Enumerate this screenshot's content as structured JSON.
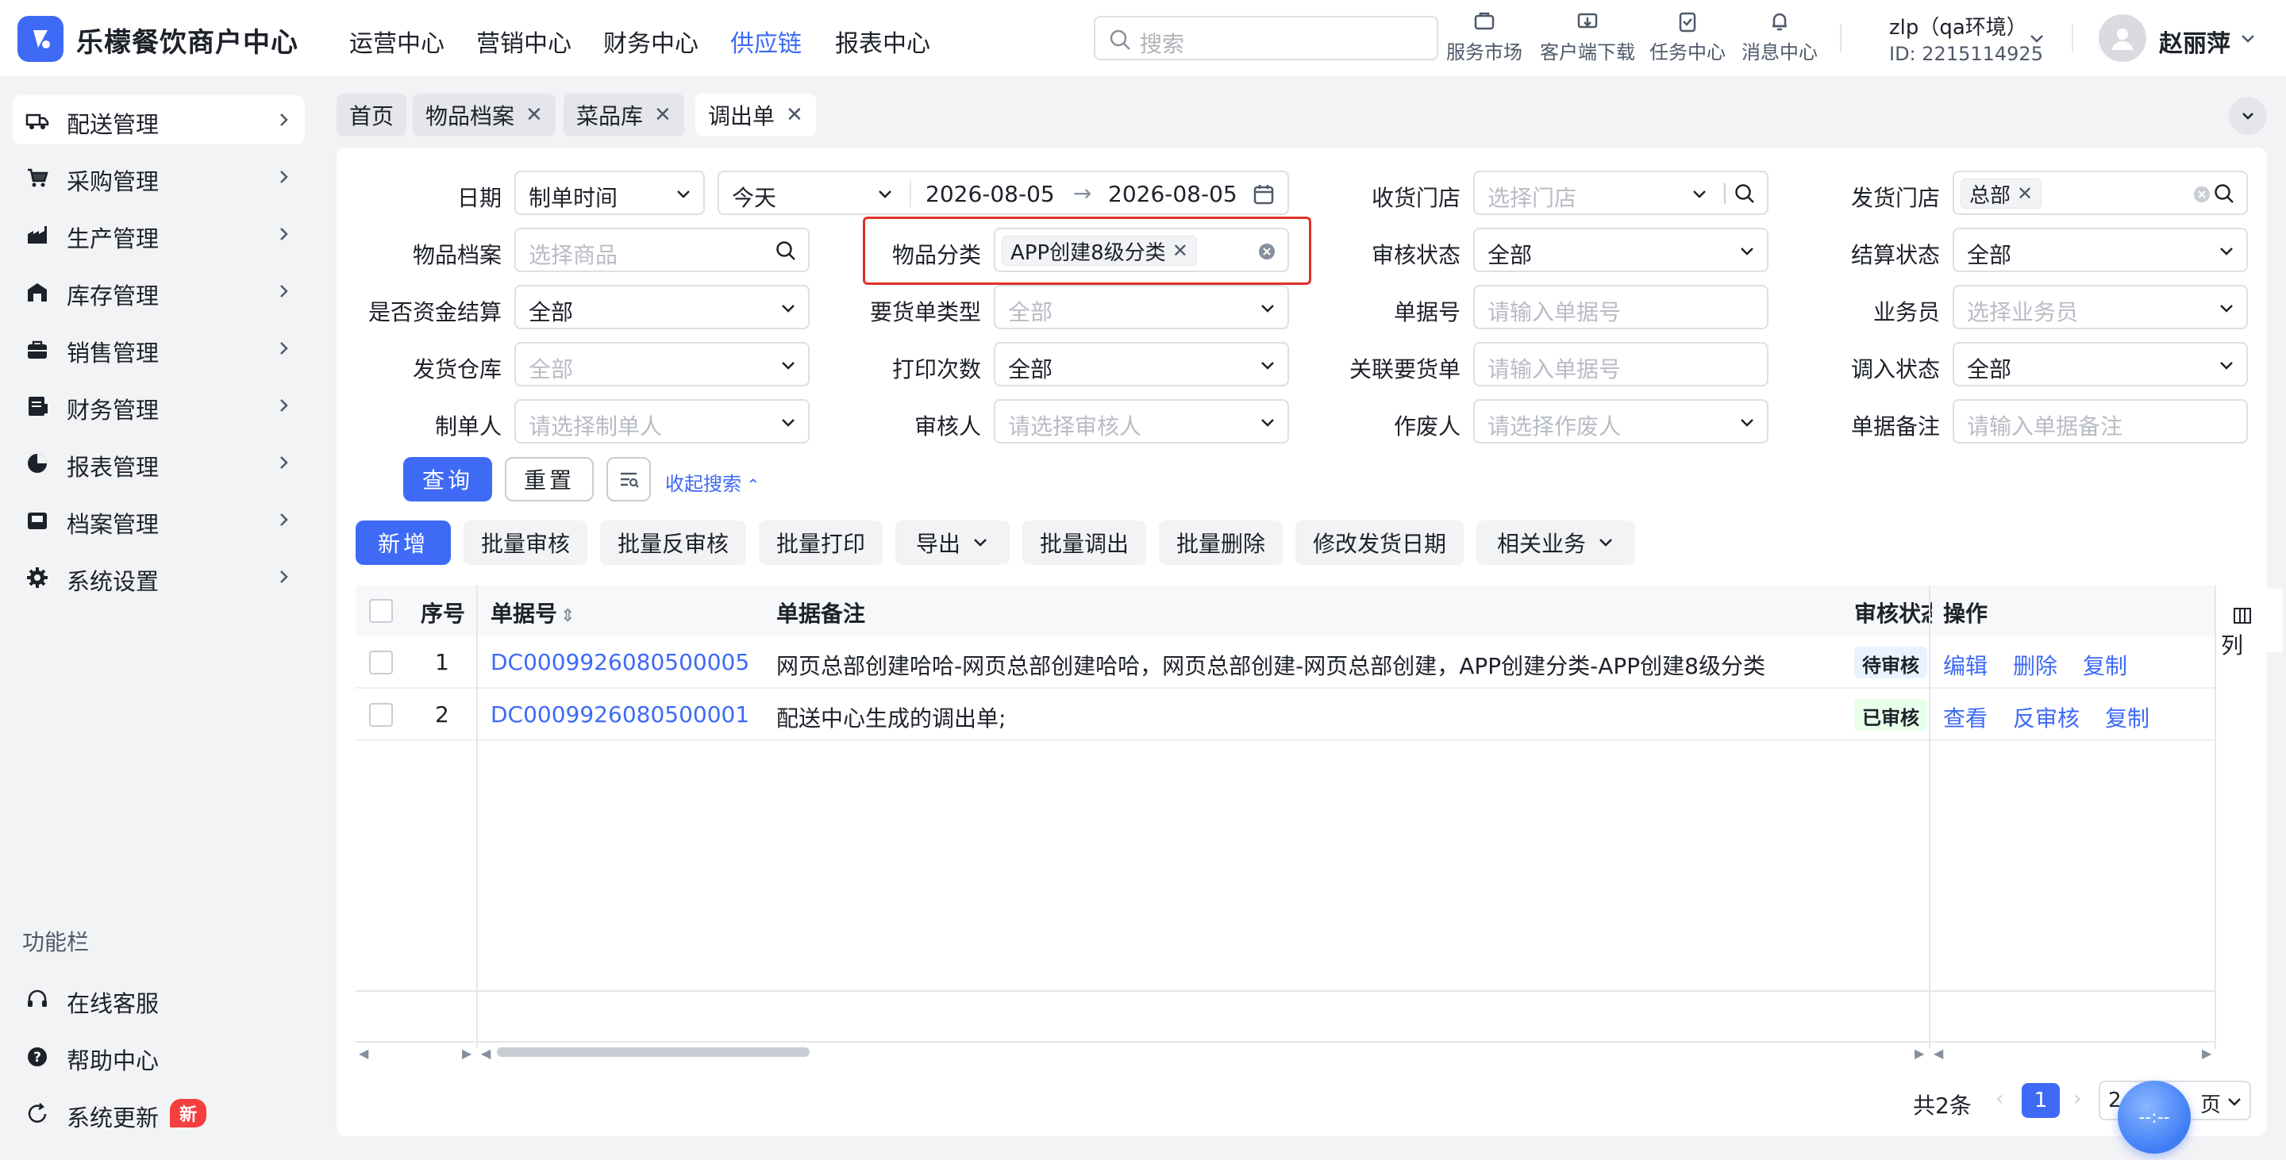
{
  "app": {
    "title": "乐檬餐饮商户中心"
  },
  "topnav": [
    "运营中心",
    "营销中心",
    "财务中心",
    "供应链",
    "报表中心"
  ],
  "search": {
    "placeholder": "搜索"
  },
  "toolbar_icons": [
    {
      "label": "服务市场",
      "icon": "store-icon"
    },
    {
      "label": "客户端下载",
      "icon": "download-icon"
    },
    {
      "label": "任务中心",
      "icon": "clipboard-icon"
    },
    {
      "label": "消息中心",
      "icon": "bell-icon"
    }
  ],
  "account": {
    "name": "zlp（qa环境）",
    "id": "ID: 2215114925",
    "user": "赵丽萍"
  },
  "sidebar": {
    "items": [
      {
        "label": "配送管理",
        "icon": "truck-icon"
      },
      {
        "label": "采购管理",
        "icon": "cart-icon"
      },
      {
        "label": "生产管理",
        "icon": "factory-icon"
      },
      {
        "label": "库存管理",
        "icon": "warehouse-icon"
      },
      {
        "label": "销售管理",
        "icon": "bag-icon"
      },
      {
        "label": "财务管理",
        "icon": "ledger-icon"
      },
      {
        "label": "报表管理",
        "icon": "pie-chart-icon"
      },
      {
        "label": "档案管理",
        "icon": "archive-icon"
      },
      {
        "label": "系统设置",
        "icon": "gear-icon"
      }
    ],
    "func_title": "功能栏",
    "func_items": [
      {
        "label": "在线客服",
        "icon": "headset-icon"
      },
      {
        "label": "帮助中心",
        "icon": "help-icon"
      },
      {
        "label": "系统更新",
        "icon": "refresh-icon"
      }
    ],
    "new_badge": "新"
  },
  "tabs": [
    "首页",
    "物品档案",
    "菜品库",
    "调出单"
  ],
  "filters": {
    "date_label": "日期",
    "date_type": "制单时间",
    "date_range": "今天",
    "date_from": "2026-08-05",
    "date_to": "2026-08-05",
    "receive_store_label": "收货门店",
    "receive_store_ph": "选择门店",
    "send_store_label": "发货门店",
    "send_store_tag": "总部",
    "item_label": "物品档案",
    "item_ph": "选择商品",
    "category_label": "物品分类",
    "category_tag": "APP创建8级分类",
    "audit_label": "审核状态",
    "audit_val": "全部",
    "settle_label": "结算状态",
    "settle_val": "全部",
    "fund_label": "是否资金结算",
    "fund_val": "全部",
    "order_type_label": "要货单类型",
    "order_type_ph": "全部",
    "doc_no_label": "单据号",
    "doc_no_ph": "请输入单据号",
    "salesman_label": "业务员",
    "salesman_ph": "选择业务员",
    "warehouse_label": "发货仓库",
    "warehouse_ph": "全部",
    "print_label": "打印次数",
    "print_val": "全部",
    "related_label": "关联要货单",
    "related_ph": "请输入单据号",
    "in_status_label": "调入状态",
    "in_status_val": "全部",
    "creator_label": "制单人",
    "creator_ph": "请选择制单人",
    "auditor_label": "审核人",
    "auditor_ph": "请选择审核人",
    "voider_label": "作废人",
    "voider_ph": "请选择作废人",
    "remark_label": "单据备注",
    "remark_ph": "请输入单据备注"
  },
  "actions": {
    "query": "查询",
    "reset": "重置",
    "collapse": "收起搜索"
  },
  "toolbar": [
    "新增",
    "批量审核",
    "批量反审核",
    "批量打印",
    "导出",
    "批量调出",
    "批量删除",
    "修改发货日期",
    "相关业务"
  ],
  "table": {
    "columns": [
      "序号",
      "单据号",
      "单据备注",
      "审核状态",
      "操作"
    ],
    "col_settings": "列",
    "rows": [
      {
        "no": "1",
        "doc": "DC0009926080500005",
        "remark": "网页总部创建哈哈-网页总部创建哈哈，网页总部创建-网页总部创建，APP创建分类-APP创建8级分类",
        "status": "待审核",
        "ops": [
          "编辑",
          "删除",
          "复制"
        ]
      },
      {
        "no": "2",
        "doc": "DC0009926080500001",
        "remark": "配送中心生成的调出单;",
        "status": "已审核",
        "ops": [
          "查看",
          "反审核",
          "复制"
        ]
      }
    ]
  },
  "pager": {
    "total": "共2条",
    "current": "1",
    "size_text": "2",
    "size_suffix": "页",
    "ball_text": "--:--"
  },
  "colors": {
    "primary": "#3e6af6",
    "highlight_border": "#e0302a",
    "badge": "#f53f3f"
  }
}
